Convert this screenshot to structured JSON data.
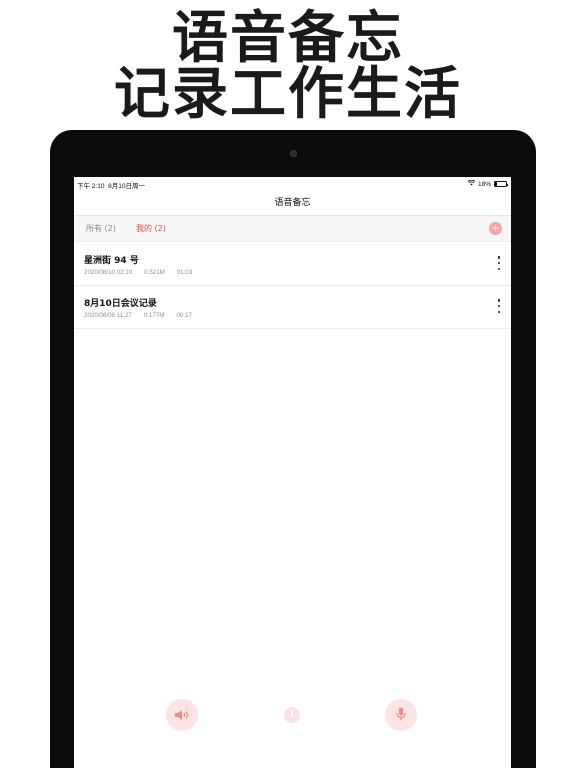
{
  "promo": {
    "line1": "语音备忘",
    "line2": "记录工作生活"
  },
  "statusbar": {
    "time": "下午 2:10",
    "date": "8月10日周一",
    "battery": "18%",
    "battery_level": 0.18,
    "wifi_icon": "wifi-icon"
  },
  "navbar": {
    "title": "语音备忘"
  },
  "tabs": [
    {
      "label": "所有 (2)",
      "active": false
    },
    {
      "label": "我的 (2)",
      "active": true
    }
  ],
  "add_icon": "plus-circle-icon",
  "recordings": [
    {
      "title": "星洲街 94 号",
      "date": "2020/08/10 02:10",
      "size": "0.521M",
      "duration": "01:03"
    },
    {
      "title": "8月10日会议记录",
      "date": "2020/08/08 11:27",
      "size": "0.177M",
      "duration": "00:17"
    }
  ],
  "bottom_bar": {
    "speaker_icon": "speaker-icon",
    "info_icon": "info-icon",
    "info_glyph": "i",
    "mic_icon": "microphone-icon"
  },
  "colors": {
    "accent": "#e8474a",
    "accent_light": "#fde4e4"
  }
}
